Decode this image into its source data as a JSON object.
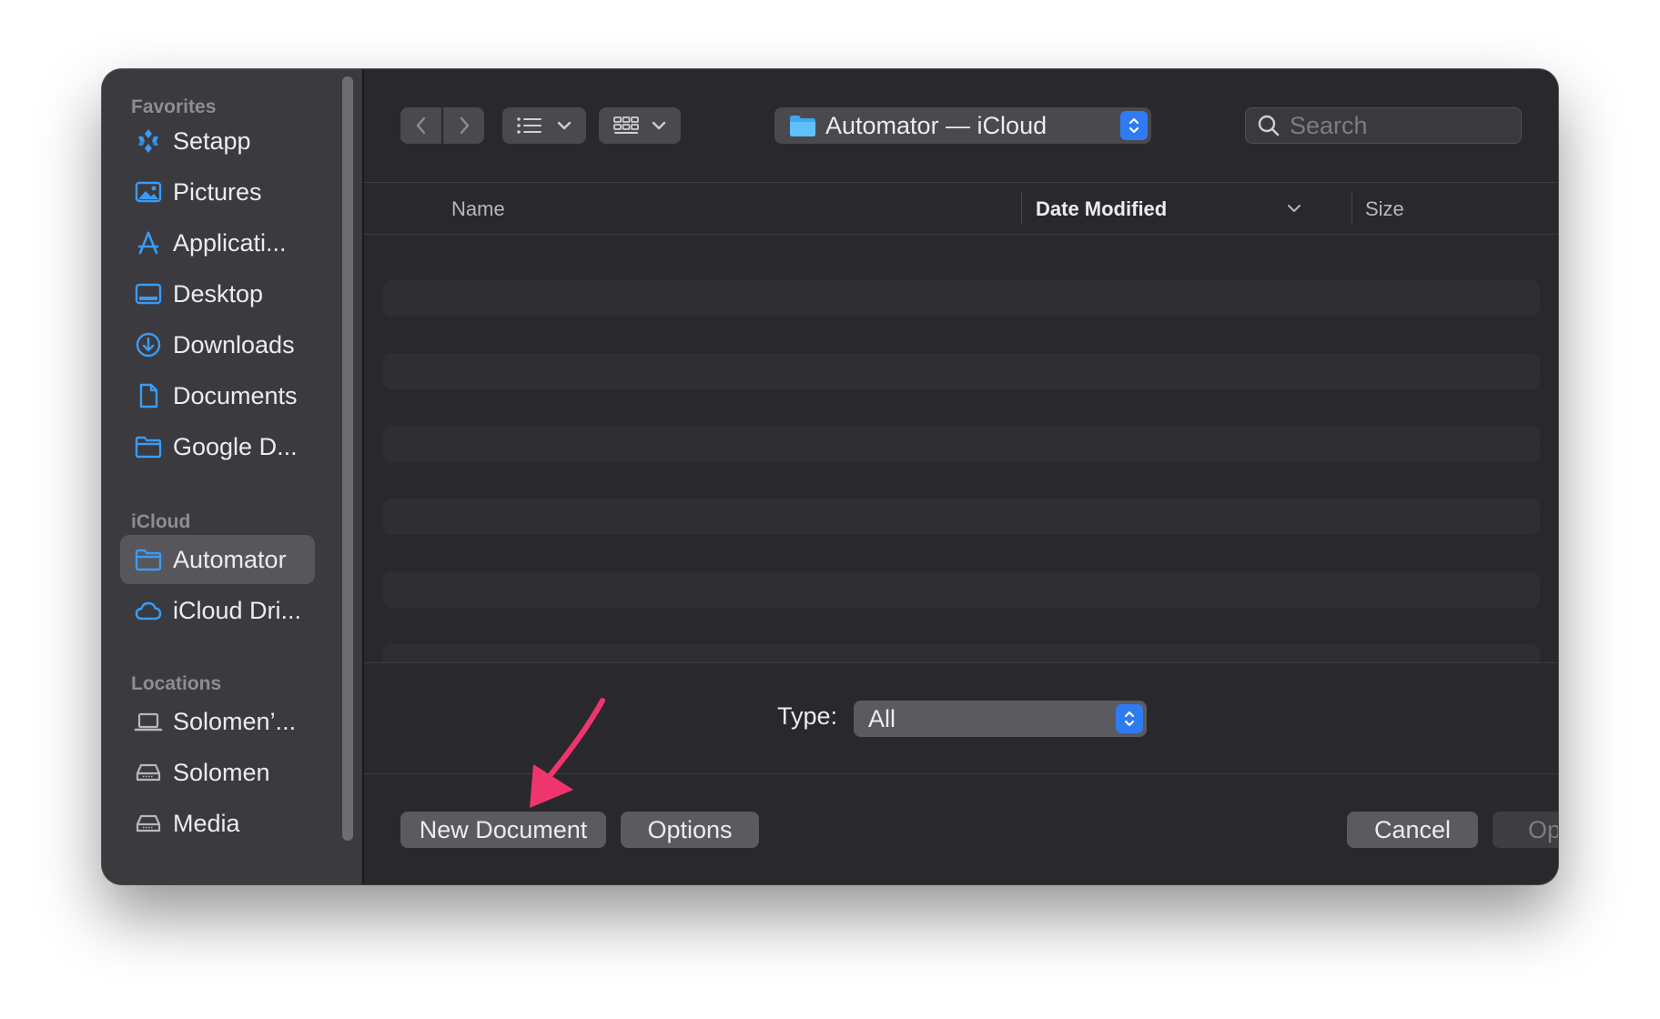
{
  "sidebar": {
    "favorites_title": "Favorites",
    "favorites": [
      {
        "label": "Setapp",
        "icon": "setapp-icon"
      },
      {
        "label": "Pictures",
        "icon": "pictures-icon"
      },
      {
        "label": "Applicati...",
        "icon": "applications-icon"
      },
      {
        "label": "Desktop",
        "icon": "desktop-icon"
      },
      {
        "label": "Downloads",
        "icon": "downloads-icon"
      },
      {
        "label": "Documents",
        "icon": "document-icon"
      },
      {
        "label": "Google D...",
        "icon": "folder-icon"
      }
    ],
    "icloud_title": "iCloud",
    "icloud": [
      {
        "label": "Automator",
        "icon": "folder-icon",
        "selected": true
      },
      {
        "label": "iCloud Dri...",
        "icon": "cloud-icon"
      }
    ],
    "locations_title": "Locations",
    "locations": [
      {
        "label": "Solomen’...",
        "icon": "laptop-icon"
      },
      {
        "label": "Solomen",
        "icon": "drive-icon"
      },
      {
        "label": "Media",
        "icon": "drive-icon"
      }
    ]
  },
  "toolbar": {
    "location": "Automator — iCloud",
    "search_placeholder": "Search"
  },
  "list": {
    "columns": [
      "Name",
      "Date Modified",
      "Size"
    ],
    "sorted_column": "Date Modified"
  },
  "type_filter": {
    "label": "Type:",
    "value": "All"
  },
  "buttons": {
    "new_document": "New Document",
    "options": "Options",
    "cancel": "Cancel",
    "open": "Open"
  },
  "colors": {
    "accent": "#2f7bf4",
    "sidebar_icon": "#3a9bf4",
    "annotation_arrow": "#f0356e"
  }
}
